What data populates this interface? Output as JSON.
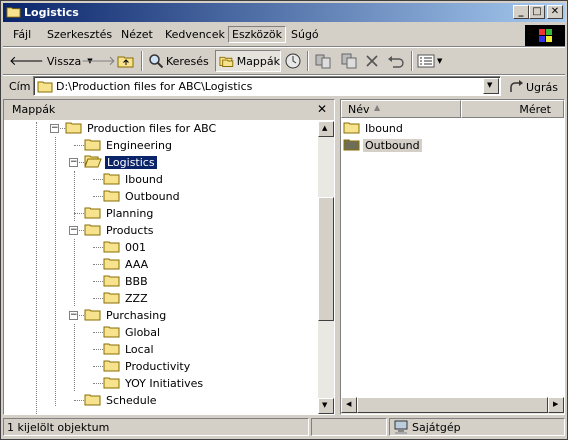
{
  "window": {
    "title": "Logistics"
  },
  "title_buttons": {
    "minimize": "_",
    "maximize": "□",
    "close": "✕"
  },
  "menu": [
    "Fájl",
    "Szerkesztés",
    "Nézet",
    "Kedvencek",
    "Eszközök",
    "Súgó"
  ],
  "toolbar": {
    "back": "Vissza",
    "search": "Keresés",
    "folders": "Mappák"
  },
  "address": {
    "label": "Cím",
    "value": "D:\\Production files for ABC\\Logistics",
    "go": "Ugrás"
  },
  "left_pane": {
    "title": "Mappák",
    "close": "✕"
  },
  "tree": [
    {
      "label": "Production files for ABC",
      "expander": "−"
    },
    {
      "label": "Engineering",
      "expander": ""
    },
    {
      "label": "Logistics",
      "expander": "−",
      "selected": true
    },
    {
      "label": "Ibound",
      "expander": ""
    },
    {
      "label": "Outbound",
      "expander": ""
    },
    {
      "label": "Planning",
      "expander": ""
    },
    {
      "label": "Products",
      "expander": "−"
    },
    {
      "label": "001",
      "expander": ""
    },
    {
      "label": "AAA",
      "expander": ""
    },
    {
      "label": "BBB",
      "expander": ""
    },
    {
      "label": "ZZZ",
      "expander": ""
    },
    {
      "label": "Purchasing",
      "expander": "−"
    },
    {
      "label": "Global",
      "expander": ""
    },
    {
      "label": "Local",
      "expander": ""
    },
    {
      "label": "Productivity",
      "expander": ""
    },
    {
      "label": "YOY Initiatives",
      "expander": ""
    },
    {
      "label": "Schedule",
      "expander": ""
    }
  ],
  "columns": {
    "name": "Név",
    "size": "Méret"
  },
  "files": [
    {
      "label": "Ibound",
      "selected": false
    },
    {
      "label": "Outbound",
      "selected": true
    }
  ],
  "status": {
    "left": "1 kijelölt objektum",
    "right": "Sajátgép"
  },
  "colors": {
    "title_start": "#0a246a",
    "title_end": "#a6caf0",
    "selection": "#0a246a",
    "folder": "#f7e28e"
  }
}
